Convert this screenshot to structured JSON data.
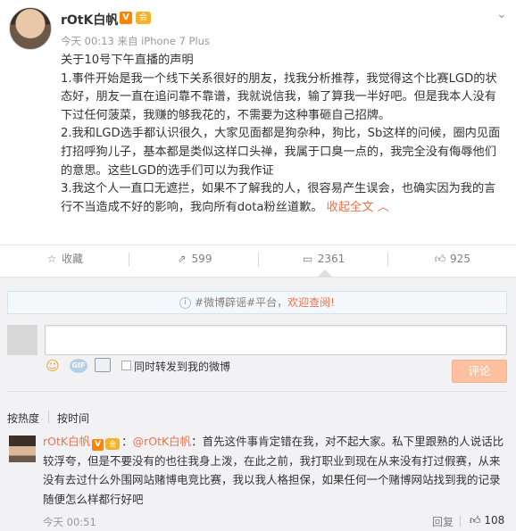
{
  "post": {
    "author": "rOtK白帆",
    "verified_badge": "V",
    "member_badge": "会",
    "meta": "今天 00:13 来自 iPhone 7 Plus",
    "expand_icon": "chevron-down-icon",
    "title": "关于10号下午直播的声明",
    "paragraph_1": "1.事件开始是我一个线下关系很好的朋友，找我分析推荐，我觉得这个比赛LGD的状态好，朋友一直在追问靠不靠谱，我就说信我，输了算我一半好吧。但是我本人没有下过任何菠菜，我赚的够我花的，不需要为这种事砸自己招牌。",
    "paragraph_2": "2.我和LGD选手都认识很久，大家见面都是狗杂种，狗比，Sb这样的问候，圈内见面打招呼狗儿子，基本都是类似这样口头禅，我属于口臭一点的，我完全没有侮辱他们的意思。这些LGD的选手们可以为我作证",
    "paragraph_3": "3.我这个人一直口无遮拦，如果不了解我的人，很容易产生误会，也确实因为我的言行不当造成不好的影响，我向所有dota粉丝道歉。",
    "collapse_label": "收起全文 ︿"
  },
  "actions": {
    "favorite": {
      "label": "收藏",
      "icon": "star-icon"
    },
    "repost": {
      "count": "599",
      "icon": "share-icon"
    },
    "comment": {
      "count": "2361",
      "icon": "comment-icon"
    },
    "like": {
      "count": "925",
      "icon": "thumbs-up-icon"
    }
  },
  "comment_panel": {
    "notice_prefix": "#微博辟谣#平台，",
    "notice_link": "欢迎查阅!",
    "repost_checkbox_label": "同时转发到我的微博",
    "submit_label": "评论",
    "sort_hot": "按热度",
    "sort_time": "按时间"
  },
  "comments": [
    {
      "user": "rOtK白帆",
      "mention": "@rOtK白帆",
      "text": "：首先这件事肯定错在我，对不起大家。私下里跟熟的人说话比较浮夸，但是不要没有的也往我身上泼，在此之前，我打职业到现在从来没有打过假赛，从来没有去过什么外围网站赌博电竞比赛，我以我人格担保，如果任何一个赌博网站找到我的记录随便怎么样都行好吧",
      "time": "今天 00:51",
      "reply_label": "回复",
      "likes": "108"
    }
  ],
  "colors": {
    "accent": "#eb7350",
    "meta": "#999999",
    "panel_bg": "#f2f2f5",
    "submit_disabled": "#ffc09f"
  }
}
